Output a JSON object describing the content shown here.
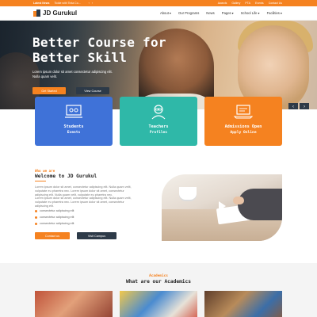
{
  "topbar": {
    "news_label": "Latest News",
    "news_text": "Tickle with Tinta Co...",
    "prev": "‹",
    "next": "›",
    "links": [
      "Awards",
      "Gallery",
      "PTA",
      "Events",
      "Contact Us"
    ]
  },
  "brand": {
    "name": "JD Gurukul",
    "accent_color": "#f58220",
    "dark_color": "#2d3a48"
  },
  "nav": {
    "items": [
      {
        "label": "About",
        "has_dropdown": true
      },
      {
        "label": "Our Programs",
        "has_dropdown": false
      },
      {
        "label": "News",
        "has_dropdown": false
      },
      {
        "label": "Pages",
        "has_dropdown": true
      },
      {
        "label": "School Life",
        "has_dropdown": true
      },
      {
        "label": "Facilities",
        "has_dropdown": true
      }
    ],
    "dropdown_glyph": "▾"
  },
  "hero": {
    "title_line1": "Better Course for",
    "title_line2": "Better Skill",
    "subtitle": "Lorem ipsum dolor sit amet consectetur adipiscing elit. Nulla quam velit.",
    "btn_start": "Get Started",
    "btn_tour": "View Course",
    "arrow_prev": "‹",
    "arrow_next": "›"
  },
  "cards": [
    {
      "line1": "Students",
      "line2": "Events",
      "color": "#3f72d8",
      "icon": "students-icon"
    },
    {
      "line1": "Teachers",
      "line2": "Profiles",
      "color": "#2fb8a8",
      "icon": "teacher-icon"
    },
    {
      "line1": "Admissions Open",
      "line2": "Apply Online",
      "color": "#f58220",
      "icon": "laptop-icon"
    }
  ],
  "welcome": {
    "eyebrow": "Who we are",
    "title": "Welcome to JD Gurukul",
    "para1": "Lorem ipsum dolor sit amet, consectetur adipiscing elit. Nulla quam velit, vulputate eu pharetra nec. Lorem ipsum dolor sit amet, consectetur adipiscing elit. Nulla quam velit, vulputate eu pharetra nec.",
    "para2": "Lorem ipsum dolor sit amet, consectetur adipiscing elit. Nulla quam velit, vulputate eu pharetra nec. Lorem ipsum dolor sit amet, consectetur adipiscing elit.",
    "checks": [
      "consectetur adipiscing elit",
      "consectetur adipiscing elit",
      "consectetur adipiscing elit"
    ],
    "btn_contact": "Contact us",
    "btn_visit": "Visit Campus"
  },
  "academics": {
    "eyebrow": "Academics",
    "title": "What are our Academics"
  }
}
